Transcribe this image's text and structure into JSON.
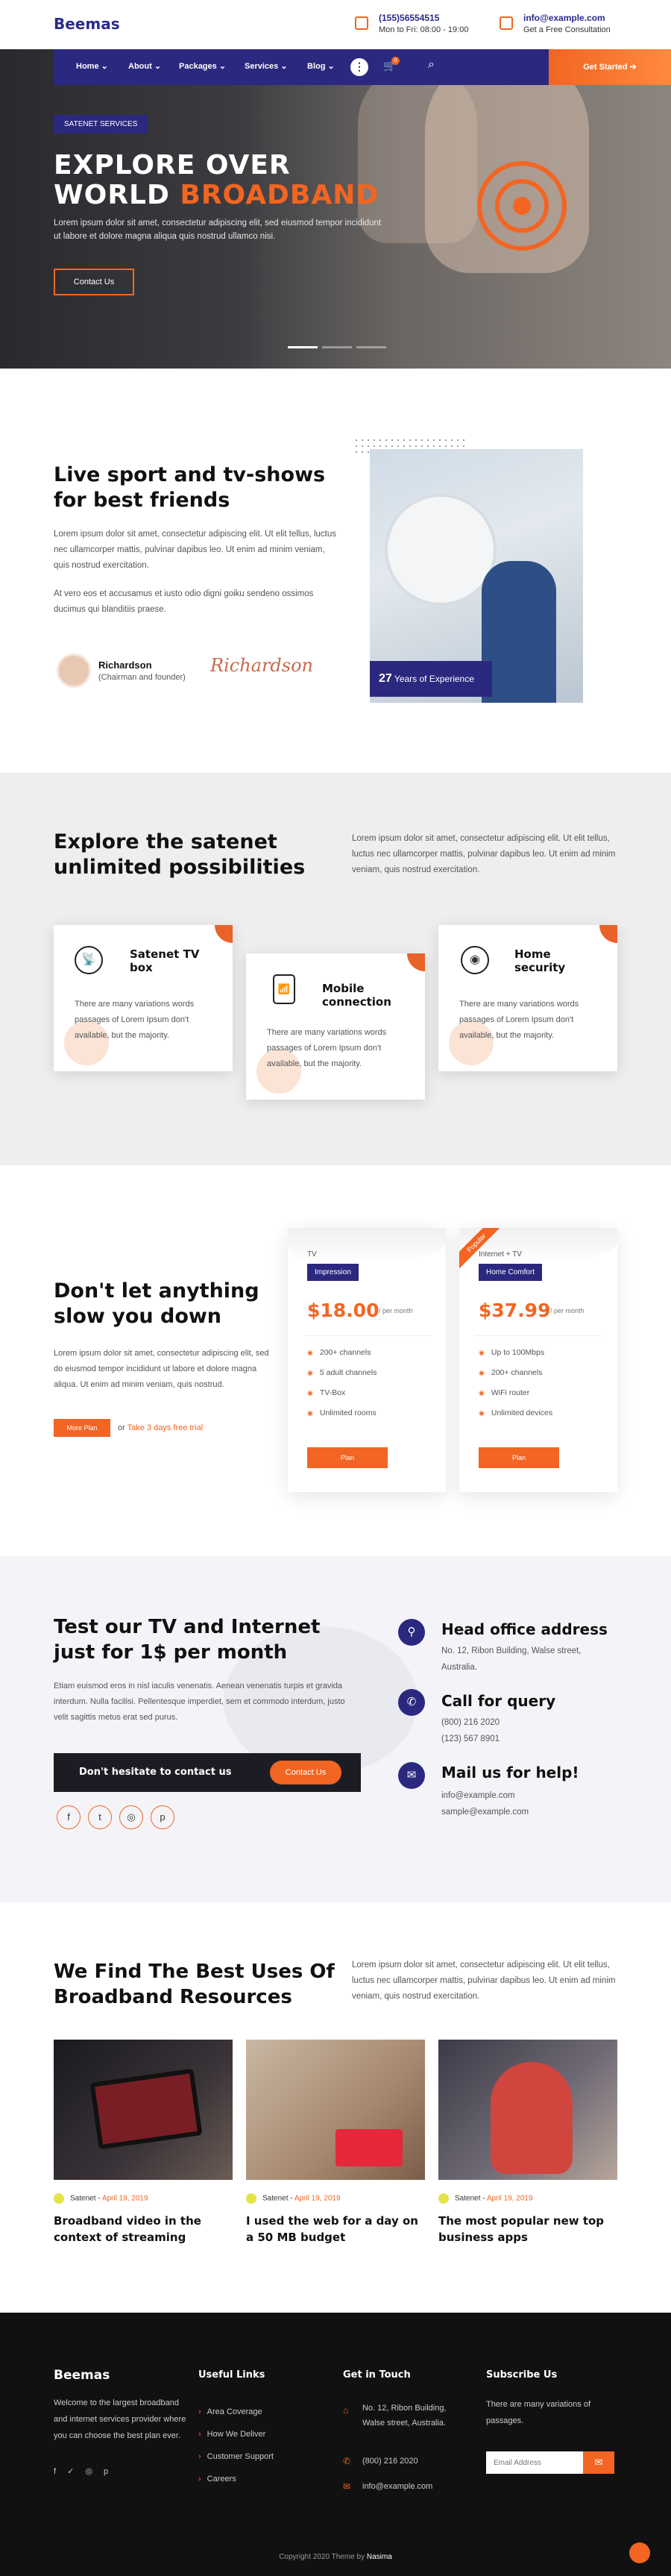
{
  "header": {
    "logo": "Beemas",
    "phone": "(155)56554515",
    "hours": "Mon to Fri: 08:00 - 19:00",
    "email": "info@example.com",
    "consult": "Get a Free Consultation"
  },
  "nav": {
    "items": [
      "Home",
      "About",
      "Packages",
      "Services",
      "Blog"
    ],
    "cart_count": "0",
    "cta": "Get Started"
  },
  "hero": {
    "chip": "SATENET SERVICES",
    "title_line1": "EXPLORE OVER",
    "title_line2_white": "WORLD ",
    "title_line2_orange": "BROADBAND",
    "text": "Lorem ipsum dolor sit amet, consectetur adipiscing elit, sed eiusmod tempor incididunt ut labore et dolore magna aliqua quis nostrud ullamco nisi.",
    "button": "Contact Us"
  },
  "about": {
    "title": "Live sport and tv-shows for best friends",
    "para1": "Lorem ipsum dolor sit amet, consectetur adipiscing elit. Ut elit tellus, luctus nec ullamcorper mattis, pulvinar dapibus leo. Ut enim ad minim veniam, quis nostrud exercitation.",
    "para2": "At vero eos et accusamus et iusto odio digni goiku sendeno ossimos ducimus qui blanditiis praese.",
    "person_name": "Richardson",
    "person_role": "(Chairman and founder)",
    "signature": "Richardson",
    "years_num": "27",
    "years_text": "Years of Experience"
  },
  "explore": {
    "title": "Explore the satenet unlimited possibilities",
    "text": "Lorem ipsum dolor sit amet, consectetur adipiscing elit. Ut elit tellus, luctus nec ullamcorper mattis, pulvinar dapibus leo. Ut enim ad minim veniam, quis nostrud exercitation.",
    "cards": [
      {
        "title": "Satenet TV box",
        "text": "There are many variations words passages of Lorem Ipsum don't available, but the majority."
      },
      {
        "title": "Mobile connection",
        "text": "There are many variations words passages of Lorem Ipsum don't available, but the majority."
      },
      {
        "title": "Home security",
        "text": "There are many variations words passages of Lorem Ipsum don't available, but the majority."
      }
    ]
  },
  "pricing": {
    "title": "Don't let anything slow you down",
    "text": "Lorem ipsum dolor sit amet, consectetur adipiscing elit, sed do eiusmod tempor incididunt ut labore et dolore magna aliqua. Ut enim ad minim veniam, quis nostrud.",
    "more_btn": "More Plan",
    "or_text": "or",
    "trial": "Take 3 days free trial",
    "plans": [
      {
        "category": "TV",
        "name": "Impression",
        "price": "$18.00",
        "per": "/ per month",
        "features": [
          "200+ channels",
          "5 adult channels",
          "TV-Box",
          "Unlimited rooms"
        ],
        "button": "Plan",
        "badge": ""
      },
      {
        "category": "Internet + TV",
        "name": "Home Comfort",
        "price": "$37.99",
        "per": "/ per month",
        "features": [
          "Up to 100Mbps",
          "200+ channels",
          "WiFi router",
          "Unlimited devices"
        ],
        "button": "Plan",
        "badge": "Popular"
      }
    ]
  },
  "contact": {
    "title": "Test our TV and Internet just for 1$ per month",
    "text": "Etiam euismod eros in nisl iaculis venenatis. Aenean venenatis turpis et gravida interdum. Nulla facilisi. Pellentesque imperdiet, sem et commodo interdum, justo velit sagittis metus erat sed purus.",
    "banner_text": "Don't hesitate to contact us",
    "banner_btn": "Contact Us",
    "socials": [
      "f",
      "t",
      "◎",
      "p"
    ],
    "items": [
      {
        "title": "Head office address",
        "lines": [
          "No. 12, Ribon Building, Walse street,",
          "Australia."
        ]
      },
      {
        "title": "Call for query",
        "lines": [
          "(800) 216 2020",
          "(123) 567 8901"
        ]
      },
      {
        "title": "Mail us for help!",
        "lines": [
          "info@example.com",
          "sample@example.com"
        ]
      }
    ]
  },
  "blog": {
    "title": "We Find The Best Uses Of Broadband Resources",
    "text": "Lorem ipsum dolor sit amet, consectetur adipiscing elit. Ut elit tellus, luctus nec ullamcorper mattis, pulvinar dapibus leo. Ut enim ad minim veniam, quis nostrud exercitation.",
    "posts": [
      {
        "author": "Satenet",
        "date": "April 19, 2019",
        "title": "Broadband video in the context of streaming"
      },
      {
        "author": "Satenet",
        "date": "April 19, 2019",
        "title": "I used the web for a day on a 50 MB budget"
      },
      {
        "author": "Satenet",
        "date": "April 19, 2019",
        "title": "The most popular new top business apps"
      }
    ]
  },
  "footer": {
    "logo": "Beemas",
    "about": "Welcome to the largest broadband and internet services provider where you can choose the best plan ever.",
    "useful_title": "Useful Links",
    "links": [
      "Area Coverage",
      "How We Deliver",
      "Customer Support",
      "Careers"
    ],
    "touch_title": "Get in Touch",
    "address": "No. 12, Ribon Building, Walse street, Australia.",
    "phone": "(800) 216 2020",
    "email": "info@example.com",
    "subscribe_title": "Subscribe Us",
    "subscribe_text": "There are many variations of passages.",
    "email_placeholder": "Email Address",
    "copyright_prefix": "Copyright 2020 Theme by ",
    "copyright_brand": "Nasima"
  },
  "colors": {
    "navy": "#2b2880",
    "orange": "#f26522"
  }
}
